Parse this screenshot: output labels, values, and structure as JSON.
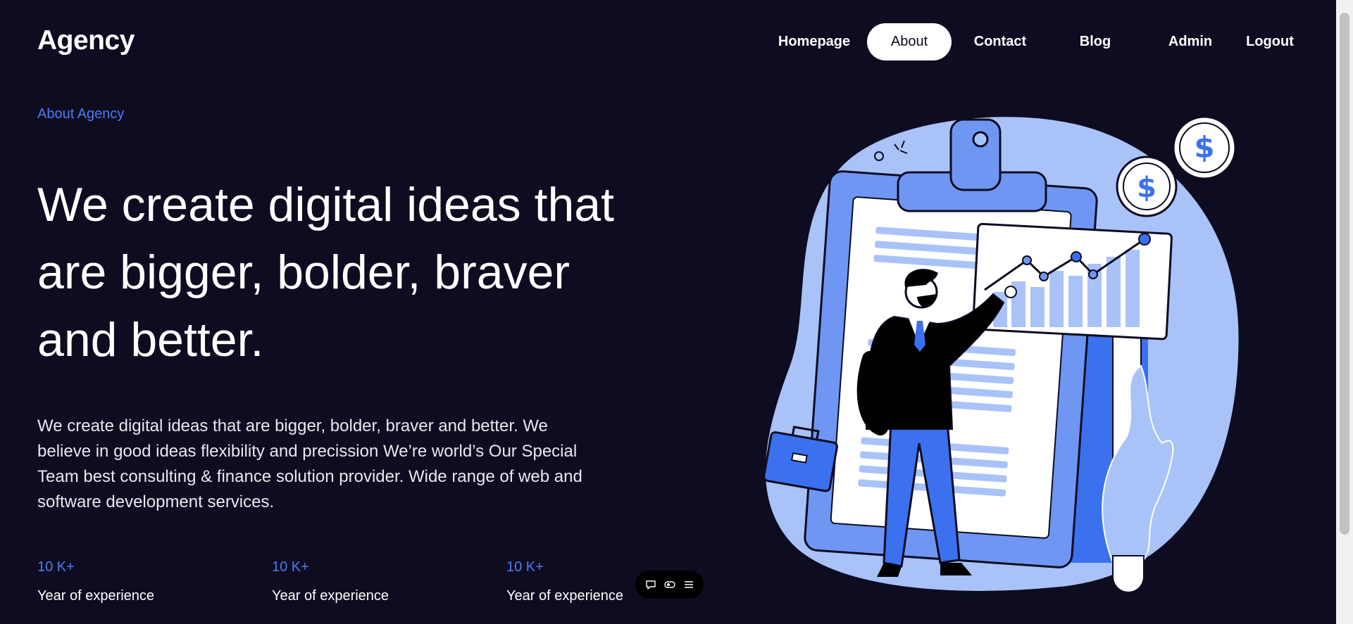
{
  "logo": "Agency",
  "nav": {
    "items": [
      {
        "label": "Homepage"
      },
      {
        "label": "About",
        "active": true
      },
      {
        "label": "Contact"
      },
      {
        "label": "Blog"
      },
      {
        "label": "Admin"
      },
      {
        "label": "Logout"
      }
    ]
  },
  "hero": {
    "eyebrow": "About Agency",
    "headline_lines": [
      "We create digital ideas that",
      "are bigger, bolder, braver",
      "and better."
    ],
    "lead_lines": [
      "We create digital ideas that are bigger, bolder, braver and better. We",
      "believe in good ideas flexibility and precission We’re world’s Our Special",
      "Team best consulting & finance solution provider. Wide range of web and",
      "software development services."
    ]
  },
  "stats": [
    {
      "value": "10 K+",
      "label": "Year of experience"
    },
    {
      "value": "10 K+",
      "label": "Year of experience"
    },
    {
      "value": "10 K+",
      "label": "Year of experience"
    }
  ],
  "toolbar": {
    "icons": [
      "comment-icon",
      "eye-toggle-icon",
      "menu-icon"
    ]
  },
  "illustration": {
    "coin_symbol": "$"
  },
  "colors": {
    "background": "#0d0c20",
    "accent": "#4f7bf0",
    "illustration_light": "#a9c2f8",
    "illustration_mid": "#6f96f2",
    "illustration_dark": "#3b71ee"
  }
}
